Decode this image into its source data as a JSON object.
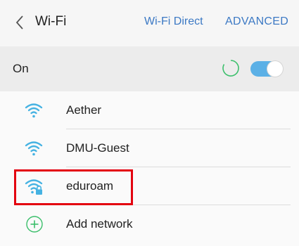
{
  "header": {
    "title": "Wi-Fi",
    "wifi_direct_label": "Wi-Fi Direct",
    "advanced_label": "ADVANCED"
  },
  "status_row": {
    "label": "On",
    "toggle_state": "on"
  },
  "networks": [
    {
      "name": "Aether",
      "icon": "wifi-icon",
      "secured": false
    },
    {
      "name": "DMU-Guest",
      "icon": "wifi-icon",
      "secured": false
    },
    {
      "name": "eduroam",
      "icon": "wifi-lock-icon",
      "secured": true,
      "highlighted": true
    }
  ],
  "add_network": {
    "label": "Add network",
    "icon": "plus-circle-icon"
  },
  "colors": {
    "accent": "#3c79c4",
    "wifi_icon": "#45b2e2",
    "toggle": "#5bb0e6",
    "spinner": "#3bbf6b",
    "highlight_box": "#e3000f"
  }
}
